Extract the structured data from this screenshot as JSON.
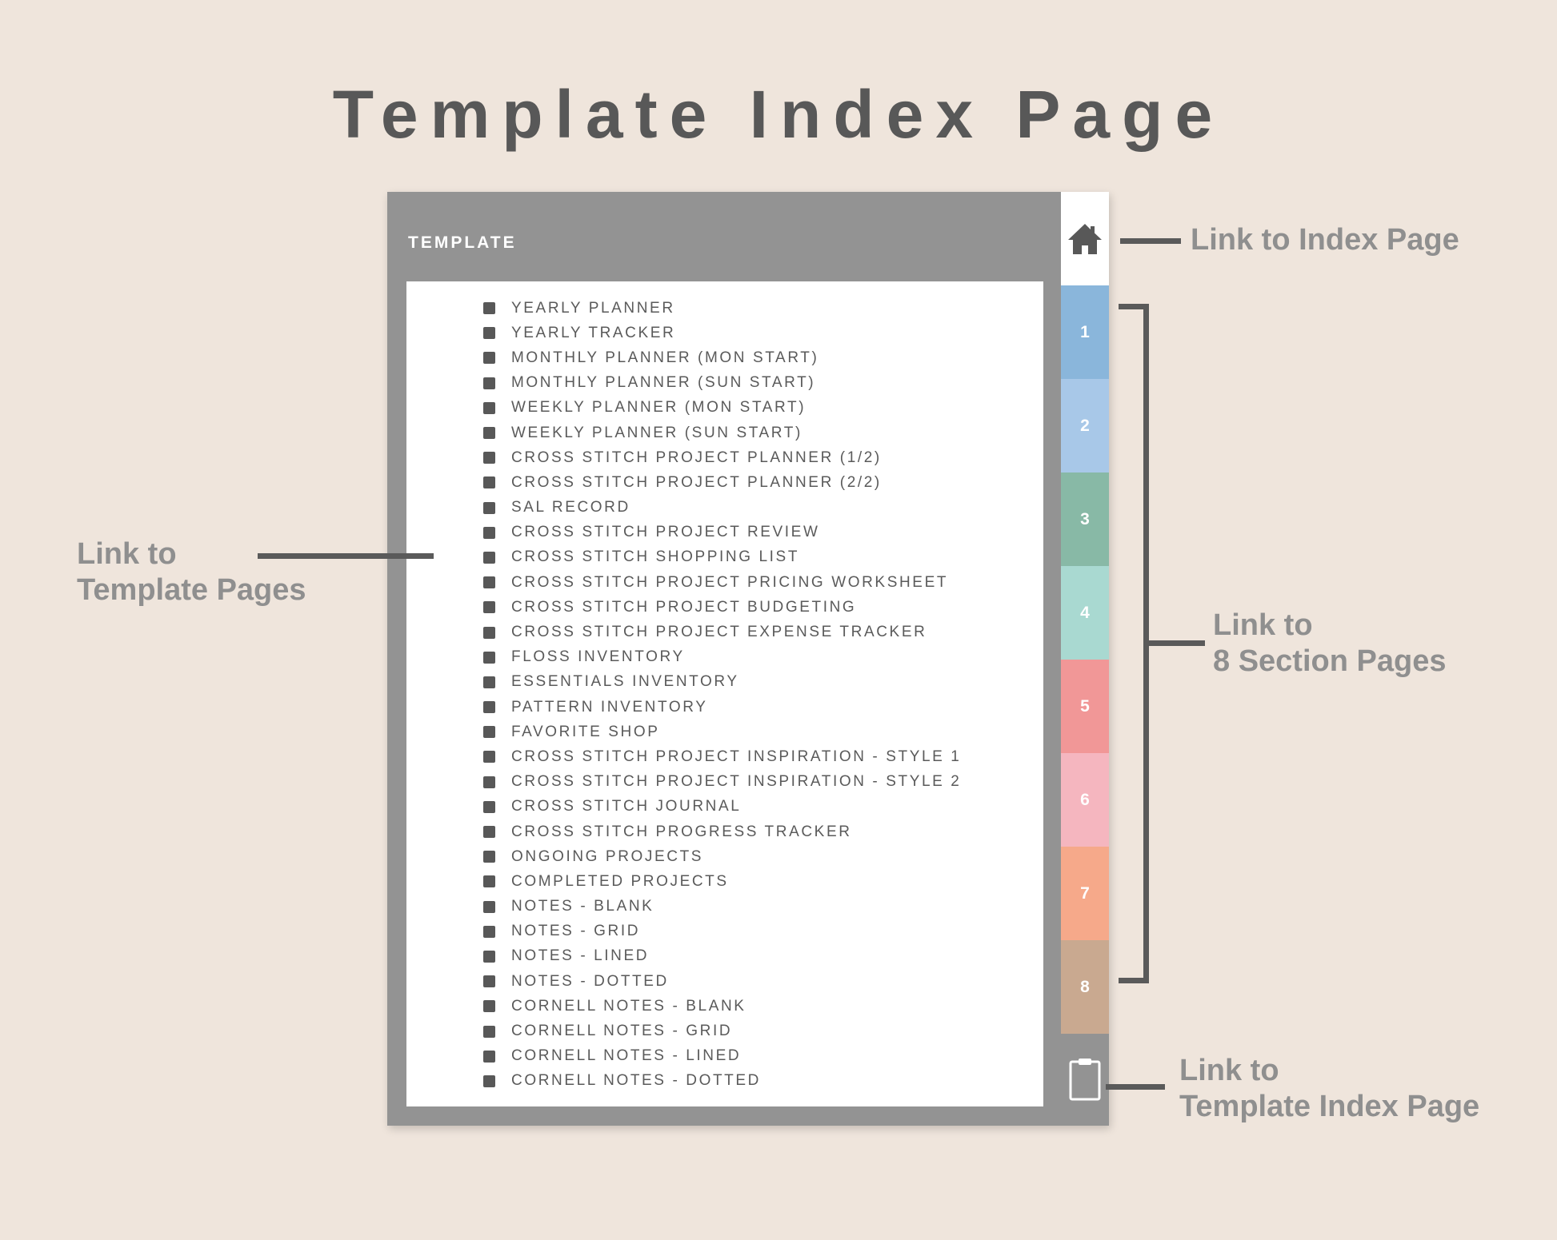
{
  "title": "Template Index Page",
  "panel": {
    "header": "TEMPLATE",
    "items": [
      "YEARLY PLANNER",
      "YEARLY TRACKER",
      "MONTHLY PLANNER (MON START)",
      "MONTHLY PLANNER (SUN START)",
      "WEEKLY PLANNER (MON START)",
      "WEEKLY PLANNER (SUN START)",
      "CROSS STITCH PROJECT PLANNER (1/2)",
      "CROSS STITCH PROJECT PLANNER (2/2)",
      "SAL RECORD",
      "CROSS STITCH PROJECT REVIEW",
      "CROSS STITCH SHOPPING LIST",
      "CROSS STITCH PROJECT PRICING WORKSHEET",
      "CROSS STITCH PROJECT BUDGETING",
      "CROSS STITCH PROJECT EXPENSE TRACKER",
      "FLOSS INVENTORY",
      "ESSENTIALS INVENTORY",
      "PATTERN INVENTORY",
      "FAVORITE SHOP",
      "CROSS STITCH PROJECT INSPIRATION - STYLE 1",
      "CROSS STITCH PROJECT INSPIRATION - STYLE 2",
      "CROSS STITCH JOURNAL",
      "CROSS STITCH PROGRESS TRACKER",
      "ONGOING PROJECTS",
      "COMPLETED PROJECTS",
      "NOTES - BLANK",
      "NOTES - GRID",
      "NOTES - LINED",
      "NOTES - DOTTED",
      "CORNELL NOTES - BLANK",
      "CORNELL NOTES - GRID",
      "CORNELL NOTES - LINED",
      "CORNELL NOTES - DOTTED"
    ]
  },
  "tabs": {
    "home_icon": "home-icon",
    "clipboard_icon": "clipboard-icon",
    "sections": [
      {
        "label": "1",
        "color": "#8ab6db"
      },
      {
        "label": "2",
        "color": "#a8c8e8"
      },
      {
        "label": "3",
        "color": "#88b9a6"
      },
      {
        "label": "4",
        "color": "#a9d9d1"
      },
      {
        "label": "5",
        "color": "#f19797"
      },
      {
        "label": "6",
        "color": "#f5b6bf"
      },
      {
        "label": "7",
        "color": "#f6a98a"
      },
      {
        "label": "8",
        "color": "#c9a990"
      }
    ]
  },
  "annotations": {
    "index_link": "Link to Index Page",
    "template_pages_line1": "Link to",
    "template_pages_line2": "Template Pages",
    "section_pages_line1": "Link to",
    "section_pages_line2": "8 Section Pages",
    "template_index_line1": "Link to",
    "template_index_line2": "Template Index Page"
  },
  "colors": {
    "background": "#efe5dc",
    "panel": "#939393",
    "text_dark": "#585858",
    "annotation": "#8f8f8f"
  }
}
